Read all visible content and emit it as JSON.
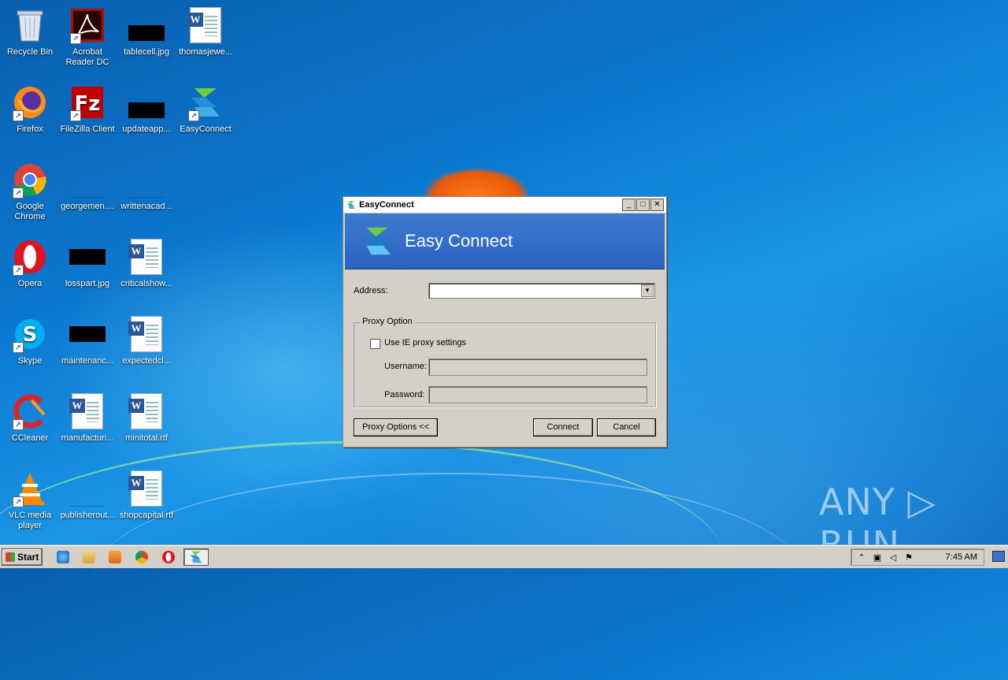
{
  "desktop": {
    "icons": [
      {
        "label": "Recycle Bin"
      },
      {
        "label": "Acrobat Reader DC"
      },
      {
        "label": "tablecell.jpg"
      },
      {
        "label": "thomasjewe..."
      },
      {
        "label": "Firefox"
      },
      {
        "label": "FileZilla Client"
      },
      {
        "label": "updateapp..."
      },
      {
        "label": "EasyConnect"
      },
      {
        "label": "Google Chrome"
      },
      {
        "label": "georgemen...."
      },
      {
        "label": "writtenacad..."
      },
      {
        "label": "Opera"
      },
      {
        "label": "losspart.jpg"
      },
      {
        "label": "criticalshow..."
      },
      {
        "label": "Skype"
      },
      {
        "label": "maintenanc..."
      },
      {
        "label": "expectedcl..."
      },
      {
        "label": "CCleaner"
      },
      {
        "label": "manufacturi..."
      },
      {
        "label": "minitotal.rtf"
      },
      {
        "label": "VLC media player"
      },
      {
        "label": "publisherout..."
      },
      {
        "label": "shopcapital.rtf"
      }
    ]
  },
  "dialog": {
    "window_title": "EasyConnect",
    "banner_title": "Easy Connect",
    "address_label": "Address:",
    "address_value": "",
    "proxy_group_label": "Proxy Option",
    "use_ie_proxy_label": "Use IE proxy settings",
    "use_ie_proxy_checked": false,
    "username_label": "Username:",
    "password_label": "Password:",
    "proxy_options_button": "Proxy Options <<",
    "connect_button": "Connect",
    "cancel_button": "Cancel",
    "minimize_glyph": "_",
    "maximize_glyph": "□",
    "close_glyph": "✕"
  },
  "taskbar": {
    "start_label": "Start",
    "clock": "7:45 AM"
  },
  "watermark": {
    "text": "ANY ▷ RUN"
  },
  "colors": {
    "banner": "#2f6cc8",
    "desktop": "#0b78cf",
    "dialog_face": "#d4d0c8"
  }
}
